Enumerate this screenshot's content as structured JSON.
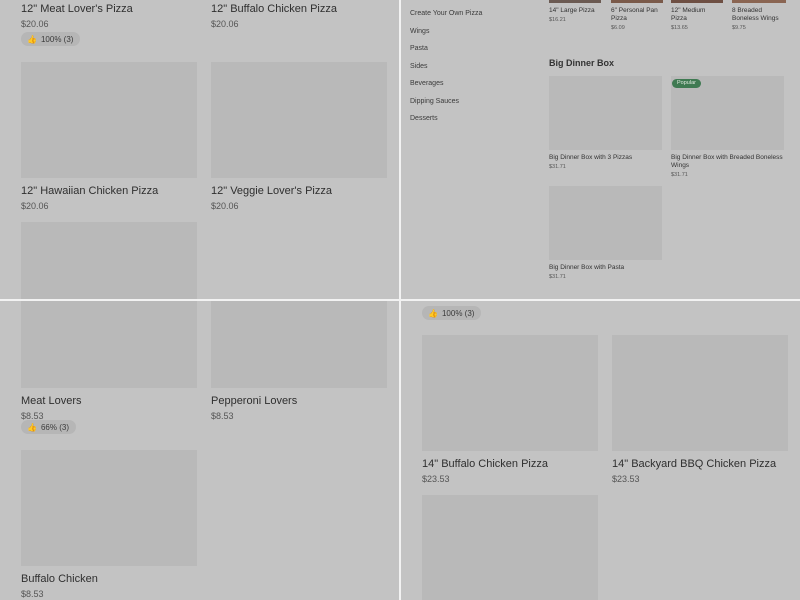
{
  "colors": {
    "background": "#c3c3c3",
    "card_image": "#b9b9b9",
    "popular_badge": "#3f7a52",
    "divider": "#f2f2f2"
  },
  "q1": {
    "top_cards": [
      {
        "title": "12\" Meat Lover's Pizza",
        "price": "$20.06"
      },
      {
        "title": "12\" Buffalo Chicken Pizza",
        "price": "$20.06"
      }
    ],
    "rating": {
      "icon": "thumbs-up-icon",
      "text": "100% (3)"
    },
    "cards": [
      {
        "title": "12\" Hawaiian Chicken Pizza",
        "price": "$20.06"
      },
      {
        "title": "12\" Veggie Lover's Pizza",
        "price": "$20.06"
      }
    ]
  },
  "q2": {
    "nav": [
      "Create Your Own Pizza",
      "Wings",
      "Pasta",
      "Sides",
      "Beverages",
      "Dipping Sauces",
      "Desserts"
    ],
    "top_row": [
      {
        "name": "14\" Large Pizza",
        "price": "$16.21"
      },
      {
        "name": "6\" Personal Pan Pizza",
        "price": "$6.09"
      },
      {
        "name": "12\" Medium Pizza",
        "price": "$13.65"
      },
      {
        "name": "8 Breaded Boneless Wings",
        "price": "$9.75"
      }
    ],
    "section_title": "Big Dinner Box",
    "popular_label": "Popular",
    "boxes": [
      {
        "name": "Big Dinner Box with 3 Pizzas",
        "price": "$31.71"
      },
      {
        "name": "Big Dinner Box with Breaded Boneless Wings",
        "price": "$31.71"
      },
      {
        "name": "Big Dinner Box with Pasta",
        "price": "$31.71"
      }
    ]
  },
  "q3": {
    "cards": [
      {
        "title": "Meat Lovers",
        "price": "$8.53"
      },
      {
        "title": "Pepperoni Lovers",
        "price": "$8.53"
      },
      {
        "title": "Buffalo Chicken",
        "price": "$8.53"
      }
    ],
    "rating": {
      "icon": "thumbs-up-icon",
      "text": "66% (3)"
    }
  },
  "q4": {
    "rating": {
      "icon": "thumbs-up-icon",
      "text": "100% (3)"
    },
    "cards": [
      {
        "title": "14\" Buffalo Chicken Pizza",
        "price": "$23.53"
      },
      {
        "title": "14\" Backyard BBQ Chicken Pizza",
        "price": "$23.53"
      }
    ]
  }
}
